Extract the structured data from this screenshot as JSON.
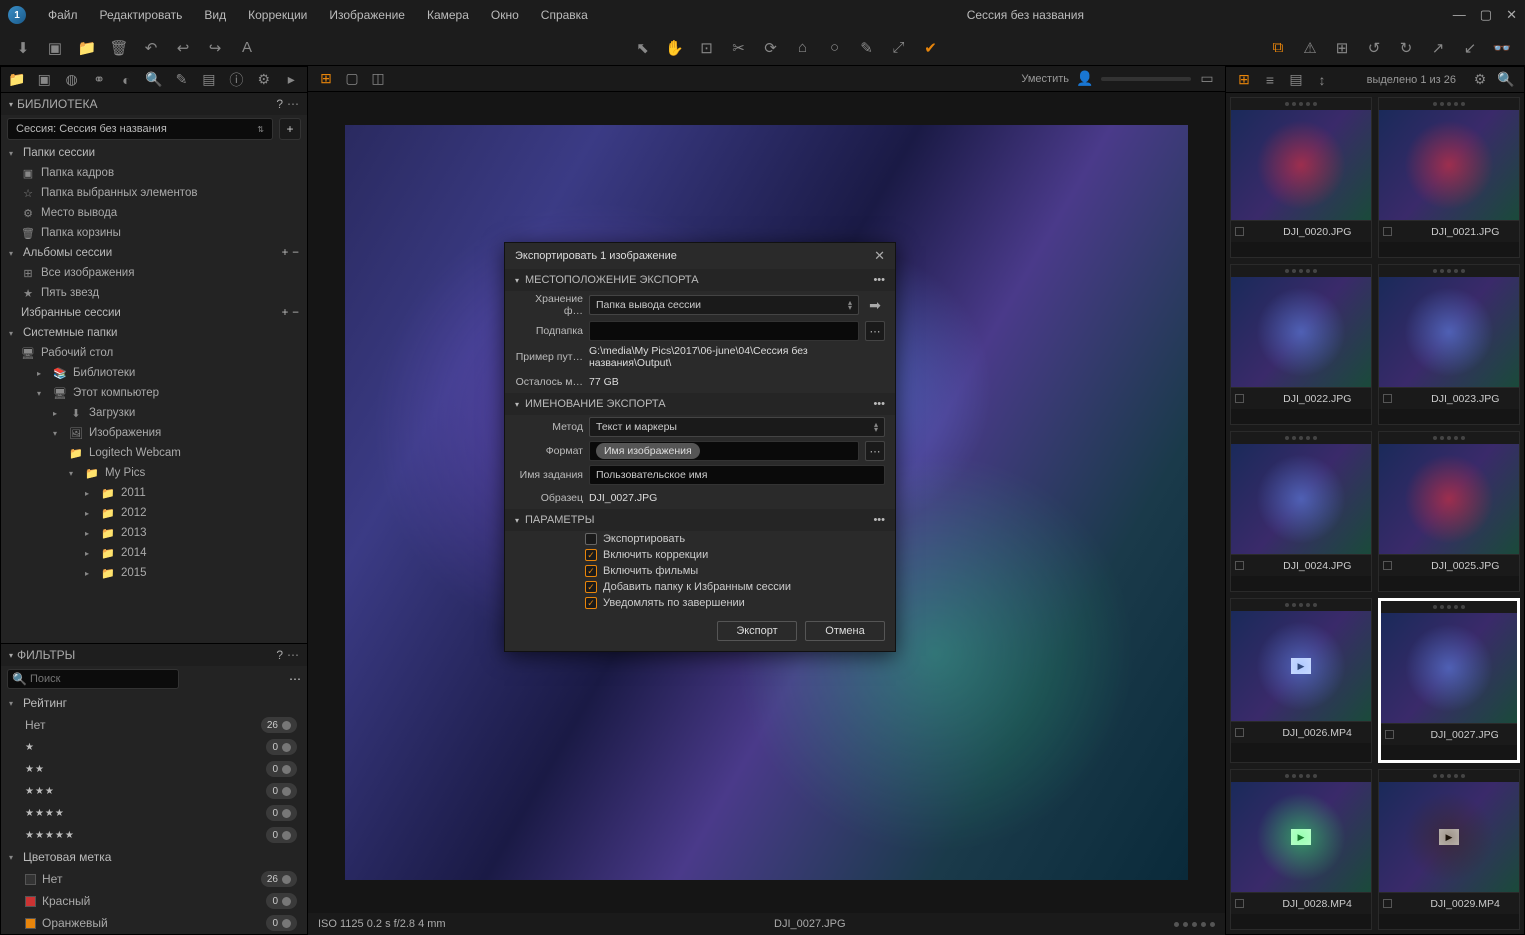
{
  "title": "Сессия без названия",
  "menu": [
    "Файл",
    "Редактировать",
    "Вид",
    "Коррекции",
    "Изображение",
    "Камера",
    "Окно",
    "Справка"
  ],
  "library": {
    "title": "БИБЛИОТЕКА",
    "session_label": "Сессия:  Сессия без названия",
    "sections": {
      "session_folders": "Папки сессии",
      "capture": "Папка кадров",
      "selects": "Папка выбранных элементов",
      "output": "Место вывода",
      "trash": "Папка корзины",
      "albums": "Альбомы сессии",
      "all_images": "Все изображения",
      "five_stars": "Пять звезд",
      "favorites": "Избранные сессии",
      "system": "Системные папки",
      "desktop": "Рабочий стол",
      "libraries": "Библиотеки",
      "this_pc": "Этот компьютер",
      "downloads": "Загрузки",
      "images": "Изображения",
      "webcam": "Logitech Webcam",
      "mypics": "My Pics",
      "y2011": "2011",
      "y2012": "2012",
      "y2013": "2013",
      "y2014": "2014",
      "y2015": "2015"
    }
  },
  "filters": {
    "title": "ФИЛЬТРЫ",
    "search_ph": "Поиск",
    "rating_title": "Рейтинг",
    "none": "Нет",
    "counts": {
      "none": "26",
      "s1": "0",
      "s2": "0",
      "s3": "0",
      "s4": "0",
      "s5": "0"
    },
    "color_title": "Цветовая метка",
    "colors": {
      "none": {
        "label": "Нет",
        "count": "26"
      },
      "red": {
        "label": "Красный",
        "count": "0",
        "hex": "#cc3333"
      },
      "orange": {
        "label": "Оранжевый",
        "count": "0",
        "hex": "#e8850b"
      }
    }
  },
  "viewer": {
    "fit": "Уместить",
    "info": "ISO 1125 0.2 s f/2.8 4 mm",
    "filename": "DJI_0027.JPG"
  },
  "browser": {
    "selected_text": "выделено 1 из 26",
    "thumbs": [
      {
        "name": "DJI_0020.JPG",
        "style": "red"
      },
      {
        "name": "DJI_0021.JPG",
        "style": "red"
      },
      {
        "name": "DJI_0022.JPG",
        "style": "blu"
      },
      {
        "name": "DJI_0023.JPG",
        "style": "blu"
      },
      {
        "name": "DJI_0024.JPG",
        "style": "blu"
      },
      {
        "name": "DJI_0025.JPG",
        "style": "red"
      },
      {
        "name": "DJI_0026.MP4",
        "style": "blu",
        "video": true
      },
      {
        "name": "DJI_0027.JPG",
        "style": "blu",
        "selected": true
      },
      {
        "name": "DJI_0028.MP4",
        "style": "grn",
        "video": true
      },
      {
        "name": "DJI_0029.MP4",
        "style": "drk",
        "video": true
      }
    ]
  },
  "dialog": {
    "title": "Экспортировать 1 изображение",
    "loc_head": "МЕСТОПОЛОЖЕНИЕ ЭКСПОРТА",
    "store_label": "Хранение ф…",
    "store_value": "Папка вывода сессии",
    "sub_label": "Подпапка",
    "sub_value": "",
    "path_label": "Пример пут…",
    "path_value": "G:\\media\\My Pics\\2017\\06-june\\04\\Сессия без названия\\Output\\",
    "space_label": "Осталось м…",
    "space_value": "77 GB",
    "name_head": "ИМЕНОВАНИЕ ЭКСПОРТА",
    "method_label": "Метод",
    "method_value": "Текст и маркеры",
    "format_label": "Формат",
    "format_chip": "Имя изображения",
    "jobname_label": "Имя задания",
    "jobname_value": "Пользовательское имя",
    "sample_label": "Образец",
    "sample_value": "DJI_0027.JPG",
    "params_head": "ПАРАМЕТРЫ",
    "checks": {
      "export": {
        "label": "Экспортировать",
        "on": false
      },
      "corrections": {
        "label": "Включить коррекции",
        "on": true
      },
      "movies": {
        "label": "Включить фильмы",
        "on": true
      },
      "favorites": {
        "label": "Добавить папку к Избранным сессии",
        "on": true
      },
      "notify": {
        "label": "Уведомлять по завершении",
        "on": true
      }
    },
    "export_btn": "Экспорт",
    "cancel_btn": "Отмена"
  }
}
